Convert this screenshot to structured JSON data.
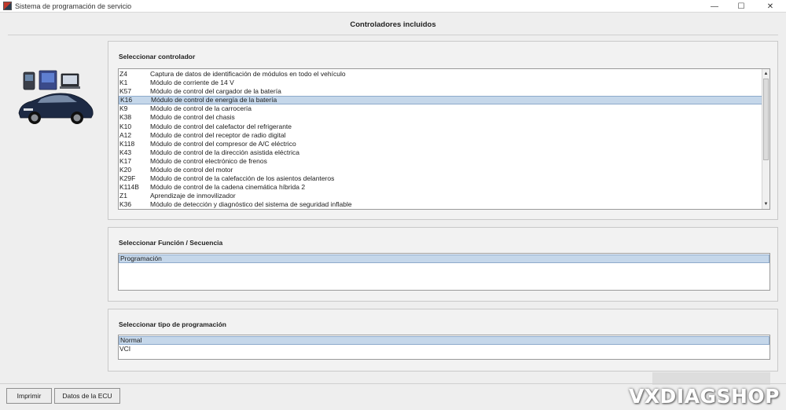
{
  "window": {
    "title": "Sistema de programación de servicio",
    "minimize_glyph": "—",
    "maximize_glyph": "☐",
    "close_glyph": "✕"
  },
  "header": {
    "title": "Controladores incluidos"
  },
  "controller_panel": {
    "title": "Seleccionar controlador",
    "selected_index": 3,
    "items": [
      {
        "code": "Z4",
        "desc": "Captura de datos de identificación de módulos en todo el vehículo"
      },
      {
        "code": "K1",
        "desc": "Módulo de corriente de 14 V"
      },
      {
        "code": "K57",
        "desc": "Módulo de control del cargador de la batería"
      },
      {
        "code": "K16",
        "desc": "Módulo de control de energía de la batería"
      },
      {
        "code": "K9",
        "desc": "Módulo de control de la carrocería"
      },
      {
        "code": "K38",
        "desc": "Módulo de control del chasis"
      },
      {
        "code": "K10",
        "desc": "Módulo de control del calefactor del refrigerante"
      },
      {
        "code": "A12",
        "desc": "Módulo de control del receptor de radio digital"
      },
      {
        "code": "K118",
        "desc": "Módulo de control del compresor de A/C eléctrico"
      },
      {
        "code": "K43",
        "desc": "Módulo de control de la dirección asistida eléctrica"
      },
      {
        "code": "K17",
        "desc": "Módulo de control electrónico de frenos"
      },
      {
        "code": "K20",
        "desc": "Módulo de control del motor"
      },
      {
        "code": "K29F",
        "desc": "Módulo de control de la calefacción de los asientos delanteros"
      },
      {
        "code": "K114B",
        "desc": "Módulo de control de la cadena cinemática híbrida 2"
      },
      {
        "code": "Z1",
        "desc": "Aprendizaje de inmovilizador"
      },
      {
        "code": "K36",
        "desc": "Módulo de detección y diagnóstico del sistema de seguridad inflable"
      }
    ]
  },
  "function_panel": {
    "title": "Seleccionar Función / Secuencia",
    "items": [
      {
        "label": "Programación"
      }
    ],
    "selected_index": 0
  },
  "type_panel": {
    "title": "Seleccionar tipo de programación",
    "items": [
      {
        "label": "Normal"
      },
      {
        "label": "VCI"
      }
    ],
    "selected_index": 0
  },
  "footer": {
    "print_label": "Imprimir",
    "ecu_label": "Datos de la ECU",
    "watermark": "VXDIAGSHOP"
  },
  "colors": {
    "selection_bg": "#c5d7ea",
    "selection_border": "#8eaacb",
    "panel_bg": "#f2f2f2"
  },
  "icons": [
    "app-icon",
    "car-diagnostic-illustration",
    "scroll-up-arrow",
    "scroll-down-arrow"
  ]
}
